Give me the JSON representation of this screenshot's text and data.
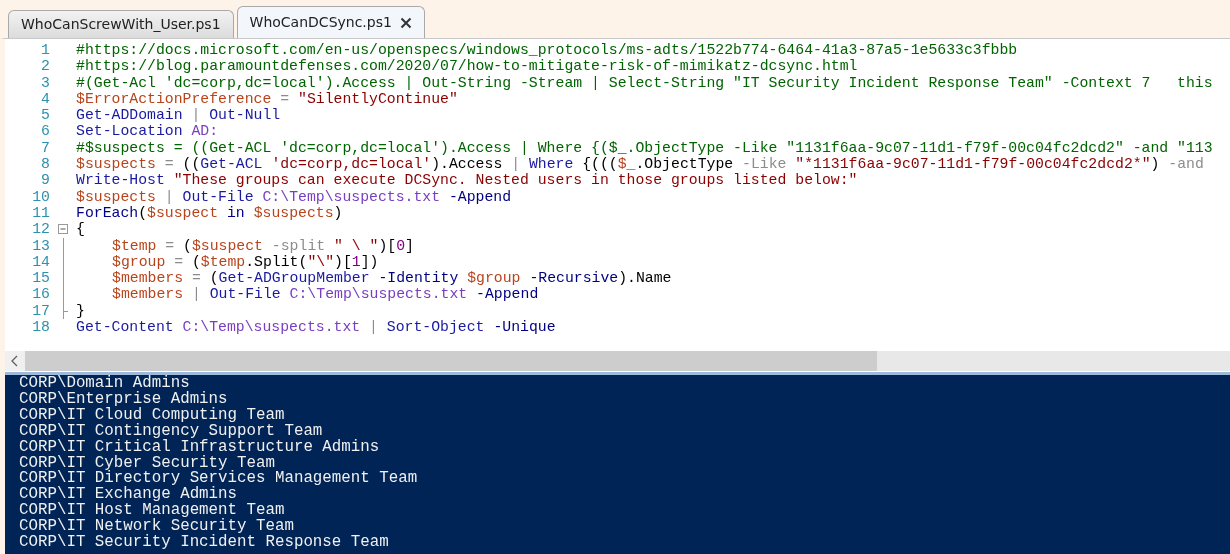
{
  "tabs": [
    {
      "label": "WhoCanScrewWith_User.ps1",
      "selected": false
    },
    {
      "label": "WhoCanDCSync.ps1",
      "selected": true
    }
  ],
  "editor": {
    "lines": [
      {
        "number": "1",
        "tokens": [
          {
            "kind": "comment",
            "t": "#https://docs.microsoft.com/en-us/openspecs/windows_protocols/ms-adts/1522b774-6464-41a3-87a5-1e5633c3fbbb"
          }
        ]
      },
      {
        "number": "2",
        "tokens": [
          {
            "kind": "comment",
            "t": "#https://blog.paramountdefenses.com/2020/07/how-to-mitigate-risk-of-mimikatz-dcsync.html"
          }
        ]
      },
      {
        "number": "3",
        "tokens": [
          {
            "kind": "comment",
            "t": "#(Get-Acl 'dc=corp,dc=local').Access | Out-String -Stream | Select-String \"IT Security Incident Response Team\" -Context 7   this"
          }
        ]
      },
      {
        "number": "4",
        "tokens": [
          {
            "kind": "variable",
            "t": "$ErrorActionPreference"
          },
          {
            "kind": "operator",
            "t": " = "
          },
          {
            "kind": "string",
            "t": "\"SilentlyContinue\""
          }
        ]
      },
      {
        "number": "5",
        "tokens": [
          {
            "kind": "command",
            "t": "Get-ADDomain"
          },
          {
            "kind": "operator",
            "t": " | "
          },
          {
            "kind": "command",
            "t": "Out-Null"
          }
        ]
      },
      {
        "number": "6",
        "tokens": [
          {
            "kind": "command",
            "t": "Set-Location"
          },
          {
            "kind": "argument",
            "t": " AD:"
          }
        ]
      },
      {
        "number": "7",
        "tokens": [
          {
            "kind": "comment",
            "t": "#$suspects = ((Get-ACL 'dc=corp,dc=local').Access | Where {($_.ObjectType -Like \"1131f6aa-9c07-11d1-f79f-00c04fc2dcd2\" -and \"113"
          }
        ]
      },
      {
        "number": "8",
        "tokens": [
          {
            "kind": "variable",
            "t": "$suspects"
          },
          {
            "kind": "operator",
            "t": " = "
          },
          {
            "kind": "plain",
            "t": "(("
          },
          {
            "kind": "command",
            "t": "Get-ACL"
          },
          {
            "kind": "string",
            "t": " 'dc=corp,dc=local'"
          },
          {
            "kind": "plain",
            "t": ").Access"
          },
          {
            "kind": "operator",
            "t": " | "
          },
          {
            "kind": "command",
            "t": "Where"
          },
          {
            "kind": "plain",
            "t": " {((("
          },
          {
            "kind": "variable",
            "t": "$_"
          },
          {
            "kind": "plain",
            "t": ".ObjectType"
          },
          {
            "kind": "operator",
            "t": " -Like "
          },
          {
            "kind": "string",
            "t": "\"*1131f6aa-9c07-11d1-f79f-00c04fc2dcd2*\""
          },
          {
            "kind": "plain",
            "t": ") "
          },
          {
            "kind": "operator",
            "t": "-and"
          }
        ]
      },
      {
        "number": "9",
        "tokens": [
          {
            "kind": "command",
            "t": "Write-Host"
          },
          {
            "kind": "string",
            "t": " \"These groups can execute DCSync. Nested users in those groups listed below:\""
          }
        ]
      },
      {
        "number": "10",
        "tokens": [
          {
            "kind": "variable",
            "t": "$suspects"
          },
          {
            "kind": "operator",
            "t": " | "
          },
          {
            "kind": "command",
            "t": "Out-File"
          },
          {
            "kind": "argument",
            "t": " C:\\Temp\\suspects.txt"
          },
          {
            "kind": "parameter",
            "t": " -Append"
          }
        ]
      },
      {
        "number": "11",
        "tokens": [
          {
            "kind": "keyword",
            "t": "ForEach"
          },
          {
            "kind": "plain",
            "t": "("
          },
          {
            "kind": "variable",
            "t": "$suspect"
          },
          {
            "kind": "keyword",
            "t": " in "
          },
          {
            "kind": "variable",
            "t": "$suspects"
          },
          {
            "kind": "plain",
            "t": ")"
          }
        ]
      },
      {
        "number": "12",
        "kind": "foldstart",
        "tokens": [
          {
            "kind": "plain",
            "t": "{"
          }
        ]
      },
      {
        "number": "13",
        "kind": "foldbody",
        "tokens": [
          {
            "kind": "variable",
            "t": "$temp"
          },
          {
            "kind": "operator",
            "t": " = "
          },
          {
            "kind": "plain",
            "t": "("
          },
          {
            "kind": "variable",
            "t": "$suspect"
          },
          {
            "kind": "operator",
            "t": " -split "
          },
          {
            "kind": "string",
            "t": "\" \\ \""
          },
          {
            "kind": "plain",
            "t": ")["
          },
          {
            "kind": "number",
            "t": "0"
          },
          {
            "kind": "plain",
            "t": "]"
          }
        ]
      },
      {
        "number": "14",
        "kind": "foldbody",
        "tokens": [
          {
            "kind": "variable",
            "t": "$group"
          },
          {
            "kind": "operator",
            "t": " = "
          },
          {
            "kind": "plain",
            "t": "("
          },
          {
            "kind": "variable",
            "t": "$temp"
          },
          {
            "kind": "plain",
            "t": ".Split("
          },
          {
            "kind": "string",
            "t": "\"\\\""
          },
          {
            "kind": "plain",
            "t": ")["
          },
          {
            "kind": "number",
            "t": "1"
          },
          {
            "kind": "plain",
            "t": "])"
          }
        ]
      },
      {
        "number": "15",
        "kind": "foldbody",
        "tokens": [
          {
            "kind": "variable",
            "t": "$members"
          },
          {
            "kind": "operator",
            "t": " = "
          },
          {
            "kind": "plain",
            "t": "("
          },
          {
            "kind": "command",
            "t": "Get-ADGroupMember"
          },
          {
            "kind": "parameter",
            "t": " -Identity "
          },
          {
            "kind": "variable",
            "t": "$group"
          },
          {
            "kind": "parameter",
            "t": " -Recursive"
          },
          {
            "kind": "plain",
            "t": ").Name"
          }
        ]
      },
      {
        "number": "16",
        "kind": "foldbody",
        "tokens": [
          {
            "kind": "variable",
            "t": "$members"
          },
          {
            "kind": "operator",
            "t": " | "
          },
          {
            "kind": "command",
            "t": "Out-File"
          },
          {
            "kind": "argument",
            "t": " C:\\Temp\\suspects.txt"
          },
          {
            "kind": "parameter",
            "t": " -Append"
          }
        ]
      },
      {
        "number": "17",
        "kind": "foldend",
        "tokens": [
          {
            "kind": "plain",
            "t": "}"
          }
        ]
      },
      {
        "number": "18",
        "tokens": [
          {
            "kind": "command",
            "t": "Get-Content"
          },
          {
            "kind": "argument",
            "t": " C:\\Temp\\suspects.txt"
          },
          {
            "kind": "operator",
            "t": " | "
          },
          {
            "kind": "command",
            "t": "Sort-Object"
          },
          {
            "kind": "parameter",
            "t": " -Unique"
          }
        ]
      }
    ]
  },
  "console": {
    "lines": [
      "CORP\\Domain Admins",
      "CORP\\Enterprise Admins",
      "CORP\\IT Cloud Computing Team",
      "CORP\\IT Contingency Support Team",
      "CORP\\IT Critical Infrastructure Admins",
      "CORP\\IT Cyber Security Team",
      "CORP\\IT Directory Services Management Team",
      "CORP\\IT Exchange Admins",
      "CORP\\IT Host Management Team",
      "CORP\\IT Network Security Team",
      "CORP\\IT Security Incident Response Team"
    ]
  }
}
